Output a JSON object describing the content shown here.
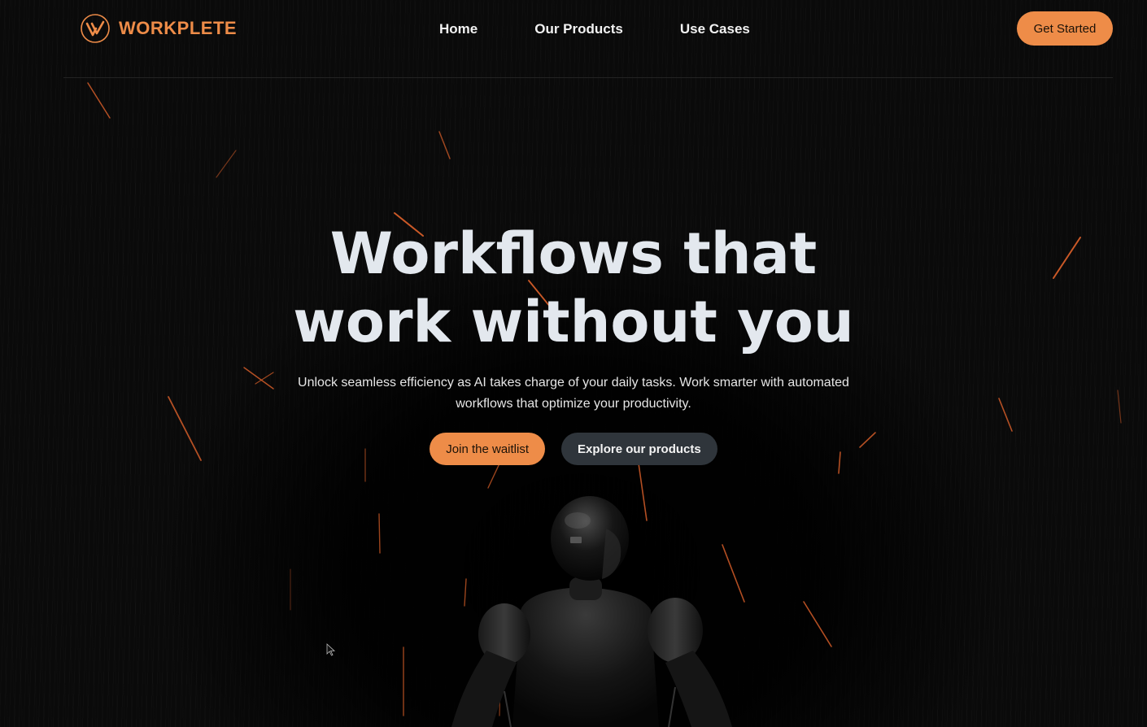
{
  "brand": {
    "name": "WORKPLETE",
    "logo_icon": "workplete-logo-icon",
    "accent_color": "#ee8c48"
  },
  "nav": {
    "items": [
      {
        "label": "Home"
      },
      {
        "label": "Our Products"
      },
      {
        "label": "Use Cases"
      }
    ],
    "cta_label": "Get Started"
  },
  "hero": {
    "title_line1": "Workflows that",
    "title_line2": "work without you",
    "subtitle": "Unlock seamless efficiency as AI takes charge of your daily tasks. Work smarter with automated workflows that optimize your productivity.",
    "primary_cta": "Join the waitlist",
    "secondary_cta": "Explore our products"
  },
  "colors": {
    "background": "#0a0a0a",
    "title": "#e3e8ee",
    "secondary_button": "#2f353b",
    "spark": "#e0622a"
  }
}
